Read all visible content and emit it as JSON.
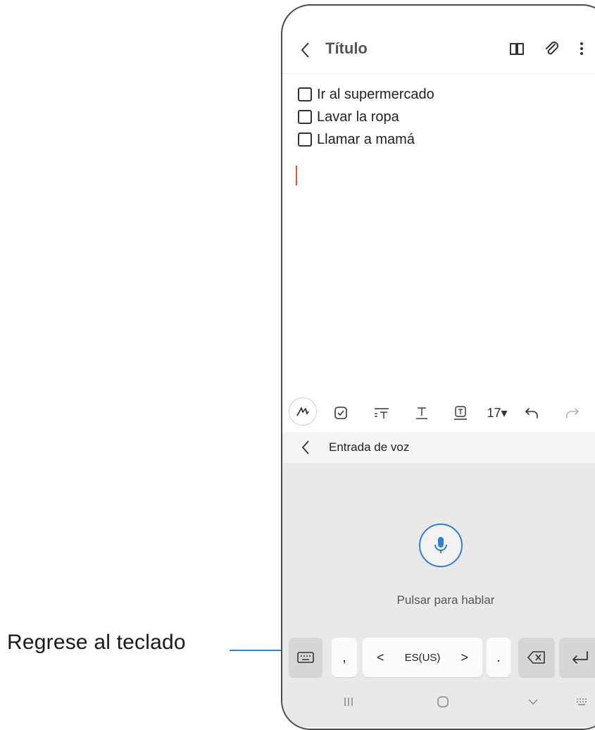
{
  "callout": {
    "label": "Regrese al teclado"
  },
  "header": {
    "title": "Título"
  },
  "checklist": [
    {
      "label": "Ir al supermercado",
      "checked": false
    },
    {
      "label": "Lavar la ropa",
      "checked": false
    },
    {
      "label": "Llamar a mamá",
      "checked": false
    }
  ],
  "toolbar": {
    "font_size": "17▾"
  },
  "voice_input": {
    "title": "Entrada de voz",
    "prompt": "Pulsar para hablar"
  },
  "keyboard": {
    "comma": ",",
    "period": ".",
    "language": "ES(US)",
    "lang_left": "<",
    "lang_right": ">"
  },
  "colors": {
    "accent": "#2f7fd6",
    "cursor": "#e8563a",
    "callout_line": "#3b82c4"
  }
}
